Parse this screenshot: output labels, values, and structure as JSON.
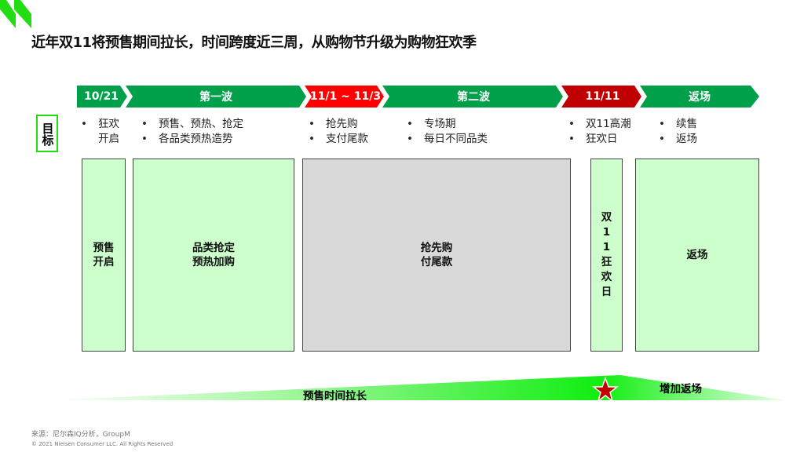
{
  "title": "近年双11将预售期间拉长，时间跨度近三周，从购物节升级为购物狂欢季",
  "timeline": [
    {
      "label": "10/21",
      "color": "#00a04a"
    },
    {
      "label": "第一波",
      "color": "#00a04a"
    },
    {
      "label": "11/1 ~ 11/3",
      "color": "#ff0000"
    },
    {
      "label": "第二波",
      "color": "#00a04a"
    },
    {
      "label": "11/11",
      "color": "#c00000"
    },
    {
      "label": "返场",
      "color": "#00a04a"
    }
  ],
  "goal_label": "目标",
  "goals": [
    [
      "狂欢开启"
    ],
    [
      "预售、预热、抢定",
      "各品类预热造势"
    ],
    [
      "抢先购",
      "支付尾款"
    ],
    [
      "专场期",
      "每日不同品类"
    ],
    [
      "双11高潮",
      "狂欢日"
    ],
    [
      "续售",
      "返场"
    ]
  ],
  "phases": [
    {
      "line1": "预售",
      "line2": "开启"
    },
    {
      "line1": "品类抢定",
      "line2": "预热加购"
    },
    {
      "line1": "抢先购",
      "line2": "付尾款"
    },
    {
      "line1": "双11狂欢日"
    },
    {
      "line1": "返场"
    }
  ],
  "bottom": {
    "left_label": "预售时间拉长",
    "right_label": "增加返场",
    "star_icon": "star-icon"
  },
  "footer": {
    "source": "来源：尼尔森IQ分析，GroupM",
    "copyright": "© 2021 Nielsen Consumer LLC. All Rights Reserved"
  }
}
